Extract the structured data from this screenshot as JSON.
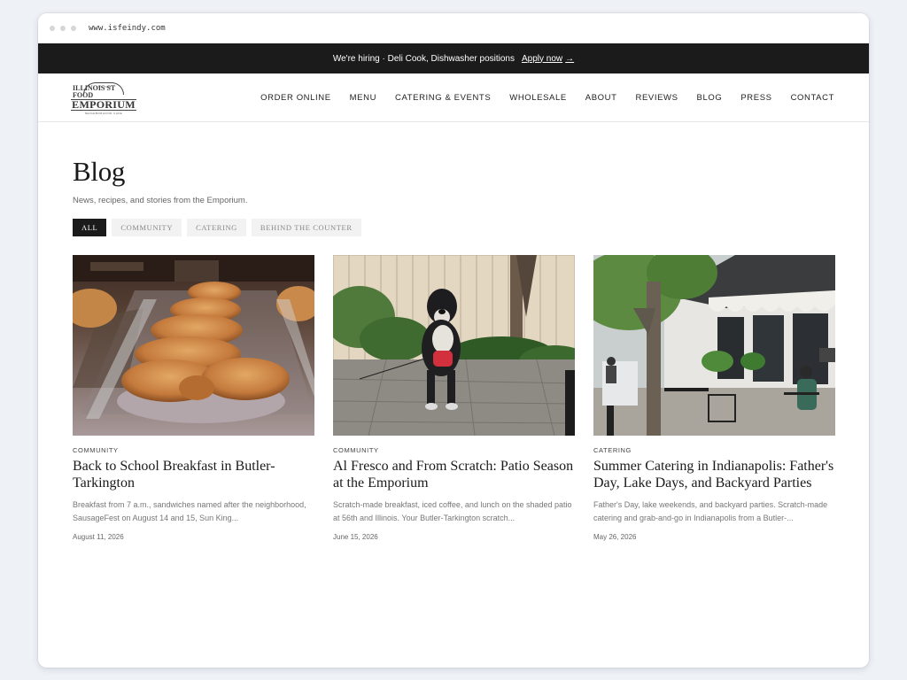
{
  "browser": {
    "url": "www.isfeindy.com"
  },
  "announcement": {
    "text": "We're hiring · Deli Cook, Dishwasher positions",
    "link": "Apply now",
    "arrow": "→"
  },
  "logo": {
    "estd": "EST. 1976",
    "line1": "ILLINOIS ST FOOD",
    "line2": "EMPORIUM",
    "line3": "NEIGHBORHOOD CAFE"
  },
  "nav": [
    "ORDER ONLINE",
    "MENU",
    "CATERING & EVENTS",
    "WHOLESALE",
    "ABOUT",
    "REVIEWS",
    "BLOG",
    "PRESS",
    "CONTACT"
  ],
  "page": {
    "title": "Blog",
    "subtitle": "News, recipes, and stories from the Emporium."
  },
  "filters": [
    "ALL",
    "COMMUNITY",
    "CATERING",
    "BEHIND THE COUNTER"
  ],
  "active_filter": "ALL",
  "posts": [
    {
      "category": "COMMUNITY",
      "title": "Back to School Breakfast in Butler-Tarkington",
      "excerpt": "Breakfast from 7 a.m., sandwiches named after the neighborhood, SausageFest on August 14 and 15, Sun King...",
      "date": "August 11, 2026",
      "image": "braided-pastry-photo"
    },
    {
      "category": "COMMUNITY",
      "title": "Al Fresco and From Scratch: Patio Season at the Emporium",
      "excerpt": "Scratch-made breakfast, iced coffee, and lunch on the shaded patio at 56th and Illinois. Your Butler-Tarkington scratch...",
      "date": "June 15, 2026",
      "image": "dog-on-patio-photo"
    },
    {
      "category": "CATERING",
      "title": "Summer Catering in Indianapolis: Father's Day, Lake Days, and Backyard Parties",
      "excerpt": "Father's Day, lake weekends, and backyard parties. Scratch-made catering and grab-and-go in Indianapolis from a Butler-...",
      "date": "May 26, 2026",
      "image": "storefront-patio-photo"
    }
  ],
  "colors": {
    "dark": "#1b1b1b",
    "filter_bg": "#f2f2f2",
    "page_bg": "#eef1f6"
  }
}
